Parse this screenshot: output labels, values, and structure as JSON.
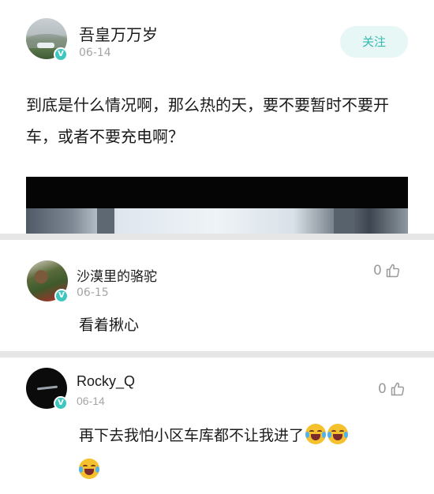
{
  "post": {
    "author_name": "吾皇万万岁",
    "date": "06-14",
    "follow_label": "关注",
    "text": "到底是什么情况啊，那么热的天，要不要暂时不要开车，或者不要充电啊？",
    "verified_badge": "V"
  },
  "comments": [
    {
      "author_name": "沙漠里的骆驼",
      "date": "06-15",
      "text": "看着揪心",
      "like_count": "0",
      "verified_badge": "V"
    },
    {
      "author_name": "Rocky_Q",
      "date": "06-14",
      "text": "再下去我怕小区车库都不让我进了",
      "emoji": [
        "tears-of-joy-emoji",
        "tears-of-joy-emoji",
        "tears-of-joy-emoji"
      ],
      "like_count": "0",
      "verified_badge": "V"
    }
  ],
  "colors": {
    "accent": "#35b8ae",
    "follow_bg": "#e7f7f6",
    "badge": "#3ec7bf",
    "divider": "#e6e6e6",
    "muted_text": "#a5a5a5"
  },
  "icons": {
    "like": "thumbs-up-icon",
    "verified": "verified-badge-icon"
  }
}
